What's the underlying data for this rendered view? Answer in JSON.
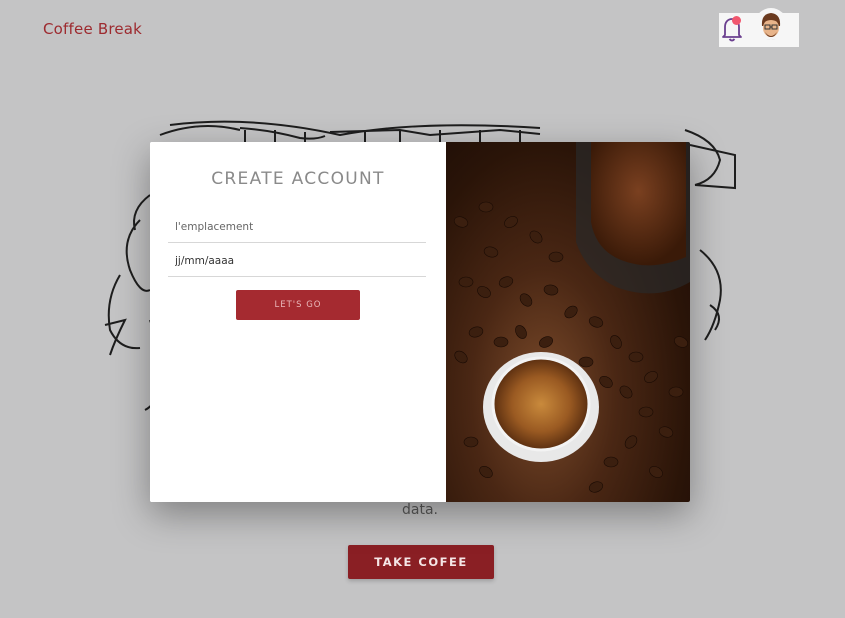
{
  "nav": {
    "brand": "Coffee Break",
    "avatar_alt": "user avatar"
  },
  "hero": {
    "visible_text": "data.",
    "cta_label": "TAKE COFEE"
  },
  "modal": {
    "title": "CREATE ACCOUNT",
    "location_placeholder": "l'emplacement",
    "date_value": "jj/mm/aaaa",
    "submit_label": "LET'S GO"
  },
  "colors": {
    "brand": "#9d2a2f",
    "button": "#a52a30",
    "cta": "#8a1f24",
    "notification": "#f1576e",
    "backdrop": "#c4c4c5"
  },
  "icons": {
    "notification": "bell-icon",
    "user": "avatar"
  }
}
